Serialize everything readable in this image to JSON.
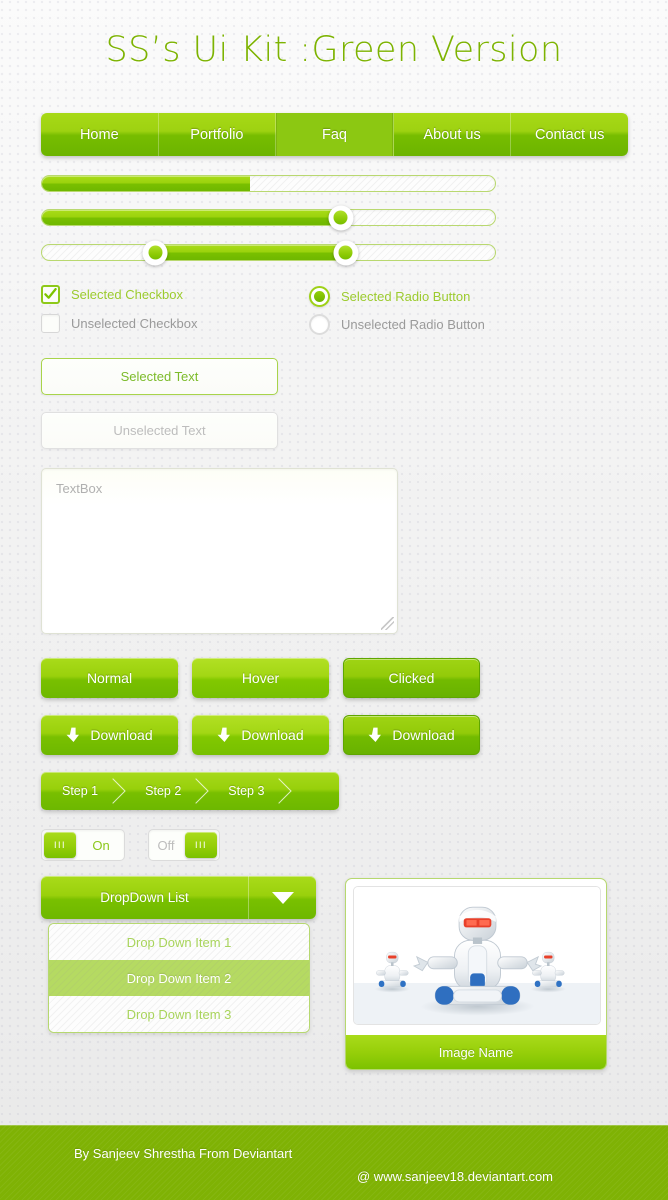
{
  "page": {
    "title": "SS’s Ui Kit :Green Version",
    "accent_green": "#7DC400",
    "accent_light": "#A9DB1A",
    "title_color": "#7DB302",
    "footer_bg": "#7FB204"
  },
  "nav": {
    "items": [
      {
        "label": "Home",
        "active": false
      },
      {
        "label": "Portfolio",
        "active": false
      },
      {
        "label": "Faq",
        "active": true
      },
      {
        "label": "About us",
        "active": false
      },
      {
        "label": "Contact us",
        "active": false
      }
    ]
  },
  "sliders": {
    "progress": {
      "name": "progress-bar",
      "percent": 46
    },
    "single": {
      "name": "single-handle-slider",
      "percent": 66
    },
    "range": {
      "name": "range-slider",
      "start_percent": 25,
      "end_percent": 67
    }
  },
  "options": {
    "checkbox_selected": {
      "label": "Selected Checkbox",
      "checked": true
    },
    "checkbox_unselected": {
      "label": "Unselected Checkbox",
      "checked": false
    },
    "radio_selected": {
      "label": "Selected Radio Button",
      "checked": true
    },
    "radio_unselected": {
      "label": "Unselected Radio Button",
      "checked": false
    }
  },
  "fields": {
    "selected_text": "Selected Text",
    "unselected_text": "Unselected Text",
    "textarea_placeholder": "TextBox"
  },
  "buttons": {
    "normal": "Normal",
    "hover": "Hover",
    "clicked": "Clicked",
    "download_1": "Download",
    "download_2": "Download",
    "download_3": "Download"
  },
  "steps": {
    "items": [
      {
        "label": "Step 1"
      },
      {
        "label": "Step 2"
      },
      {
        "label": "Step 3"
      }
    ]
  },
  "toggles": {
    "on": {
      "label": "On",
      "grip": "III",
      "state": "on"
    },
    "off": {
      "label": "Off",
      "grip": "III",
      "state": "off"
    }
  },
  "dropdown": {
    "label": "DropDown List",
    "items": [
      {
        "label": "Drop Down Item 1",
        "selected": false
      },
      {
        "label": "Drop Down Item 2",
        "selected": true
      },
      {
        "label": "Drop Down Item 3",
        "selected": false
      }
    ]
  },
  "image_panel": {
    "caption": "Image Name",
    "alt": "three meditating white robots"
  },
  "footer": {
    "author": "By Sanjeev Shrestha From Deviantart",
    "url": "@ www.sanjeev18.deviantart.com"
  }
}
